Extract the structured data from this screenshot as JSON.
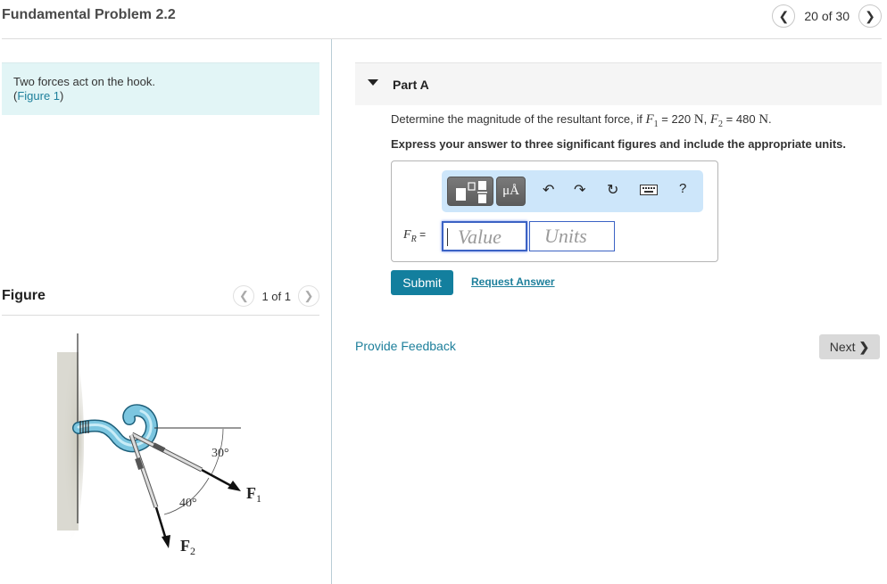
{
  "header": {
    "title": "Fundamental Problem 2.2",
    "pager": {
      "text": "20 of 30",
      "prev_icon": "chevron-left",
      "next_icon": "chevron-right"
    }
  },
  "intro": {
    "text": "Two forces act on the hook.",
    "figure_link_open": "(",
    "figure_link": "Figure 1",
    "figure_link_close": ")"
  },
  "figure_panel": {
    "title": "Figure",
    "pager_text": "1 of 1",
    "labels": {
      "angle1": "30°",
      "angle2": "40°",
      "f1": "F",
      "f1_sub": "1",
      "f2": "F",
      "f2_sub": "2"
    }
  },
  "part": {
    "label": "Part A",
    "question_prefix": "Determine the magnitude of the resultant force, if",
    "f1_sym": "F",
    "f1_sub": "1",
    "f1_val": "= 220",
    "f1_unit": "N",
    "sep": ",",
    "f2_sym": "F",
    "f2_sub": "2",
    "f2_val": "= 480",
    "f2_unit": "N",
    "end": ".",
    "instruction": "Express your answer to three significant figures and include the appropriate units."
  },
  "answer": {
    "label_sym": "F",
    "label_sub": "R",
    "label_eq": "=",
    "value_placeholder": "Value",
    "units_placeholder": "Units",
    "toolbar": {
      "template_icon": "fraction-template-icon",
      "units_label": "μÅ",
      "undo_icon": "undo",
      "redo_icon": "redo",
      "reset_icon": "reset",
      "keyboard_icon": "keyboard",
      "help_label": "?"
    }
  },
  "actions": {
    "submit": "Submit",
    "request_answer": "Request Answer",
    "provide_feedback": "Provide Feedback",
    "next": "Next"
  }
}
